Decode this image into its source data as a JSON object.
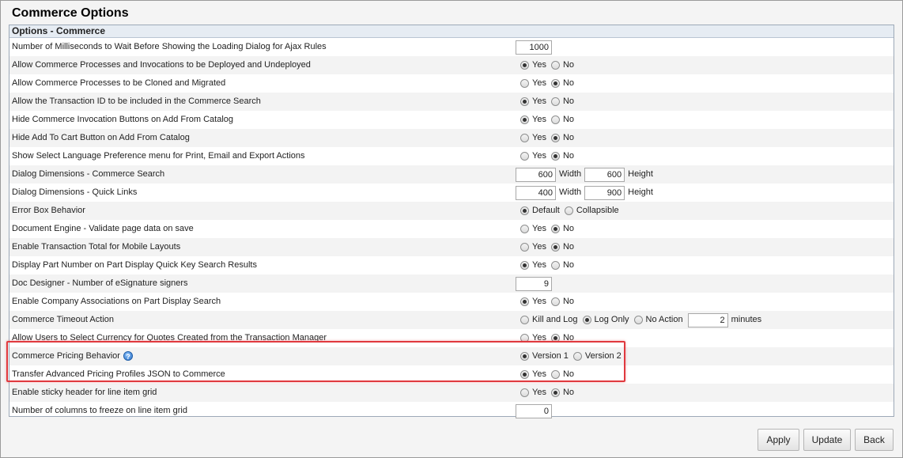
{
  "page": {
    "title": "Commerce Options"
  },
  "section": {
    "header": "Options - Commerce"
  },
  "labels": {
    "yes": "Yes",
    "no": "No",
    "width": "Width",
    "height": "Height",
    "default": "Default",
    "collapsible": "Collapsible",
    "kill_and_log": "Kill and Log",
    "log_only": "Log Only",
    "no_action": "No Action",
    "minutes": "minutes",
    "version1": "Version 1",
    "version2": "Version 2"
  },
  "rows": [
    {
      "label": "Number of Milliseconds to Wait Before Showing the Loading Dialog for Ajax Rules",
      "type": "number",
      "value": "1000"
    },
    {
      "label": "Allow Commerce Processes and Invocations to be Deployed and Undeployed",
      "type": "yesno",
      "selected": "yes"
    },
    {
      "label": "Allow Commerce Processes to be Cloned and Migrated",
      "type": "yesno",
      "selected": "no"
    },
    {
      "label": "Allow the Transaction ID to be included in the Commerce Search",
      "type": "yesno",
      "selected": "yes"
    },
    {
      "label": "Hide Commerce Invocation Buttons on Add From Catalog",
      "type": "yesno",
      "selected": "yes"
    },
    {
      "label": "Hide Add To Cart Button on Add From Catalog",
      "type": "yesno",
      "selected": "no"
    },
    {
      "label": "Show Select Language Preference menu for Print, Email and Export Actions",
      "type": "yesno",
      "selected": "no"
    },
    {
      "label": "Dialog Dimensions - Commerce Search",
      "type": "dimensions",
      "width": "600",
      "height": "600"
    },
    {
      "label": "Dialog Dimensions - Quick Links",
      "type": "dimensions",
      "width": "400",
      "height": "900"
    },
    {
      "label": "Error Box Behavior",
      "type": "errorbox",
      "selected": "default"
    },
    {
      "label": "Document Engine - Validate page data on save",
      "type": "yesno",
      "selected": "no"
    },
    {
      "label": "Enable Transaction Total for Mobile Layouts",
      "type": "yesno",
      "selected": "no"
    },
    {
      "label": "Display Part Number on Part Display Quick Key Search Results",
      "type": "yesno",
      "selected": "yes"
    },
    {
      "label": "Doc Designer - Number of eSignature signers",
      "type": "number",
      "value": "9"
    },
    {
      "label": "Enable Company Associations on Part Display Search",
      "type": "yesno",
      "selected": "yes"
    },
    {
      "label": "Commerce Timeout Action",
      "type": "timeout",
      "selected": "log_only",
      "minutes": "2"
    },
    {
      "label": "Allow Users to Select Currency for Quotes Created from the Transaction Manager",
      "type": "yesno",
      "selected": "no"
    },
    {
      "label": "Commerce Pricing Behavior",
      "type": "version",
      "selected": "version1",
      "help": true
    },
    {
      "label": "Transfer Advanced Pricing Profiles JSON to Commerce",
      "type": "yesno",
      "selected": "yes"
    },
    {
      "label": "Enable sticky header for line item grid",
      "type": "yesno",
      "selected": "no"
    },
    {
      "label": "Number of columns to freeze on line item grid",
      "type": "number",
      "value": "0"
    }
  ],
  "buttons": {
    "apply": "Apply",
    "update": "Update",
    "back": "Back"
  },
  "colors": {
    "highlight": "#e0393e",
    "section_bg": "#e6ecf3"
  }
}
